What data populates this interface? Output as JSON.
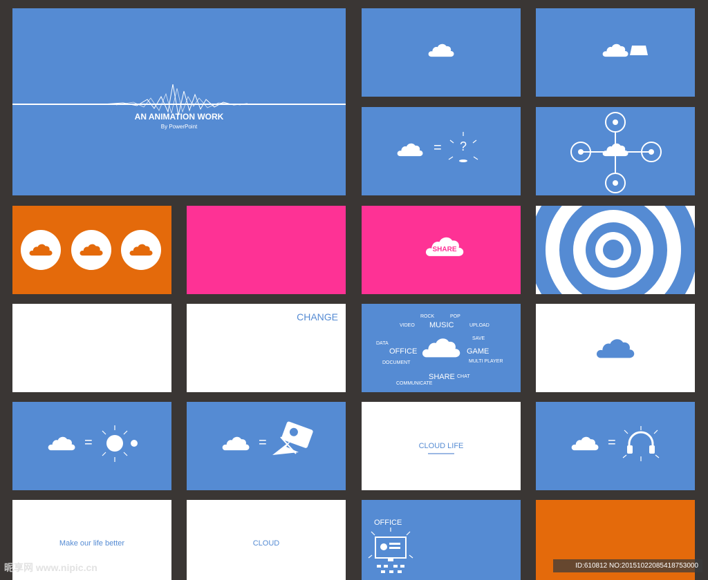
{
  "title_slide": {
    "title": "AN ANIMATION WORK",
    "subtitle": "By PowerPoint"
  },
  "share_slide": {
    "label": "SHARE"
  },
  "change_slide": {
    "label": "CHANGE"
  },
  "word_cloud": {
    "words": {
      "rock": "ROCK",
      "pop": "POP",
      "video": "VIDEO",
      "music": "MUSIC",
      "upload": "UPLOAD",
      "save": "SAVE",
      "data": "DATA",
      "office": "OFFICE",
      "game": "GAME",
      "document": "DOCUMENT",
      "multi_player": "MULTI PLAYER",
      "share": "SHARE",
      "chat": "CHAT",
      "communicate": "COMMUNICATE"
    }
  },
  "cloud_life_slide": {
    "title": "CLOUD LIFE"
  },
  "life_better_slide": {
    "text": "Make our life better"
  },
  "cloud_slide": {
    "text": "CLOUD"
  },
  "office_slide": {
    "label": "OFFICE"
  },
  "equals": "=",
  "question": "?",
  "watermark": {
    "logo": "昵享网 www.nipic.cn",
    "id": "ID:610812 NO:20151022085418753000"
  },
  "colors": {
    "background": "#3a3634",
    "blue": "#558bd3",
    "pink": "#fe3295",
    "orange": "#e46a0b",
    "white": "#ffffff"
  }
}
